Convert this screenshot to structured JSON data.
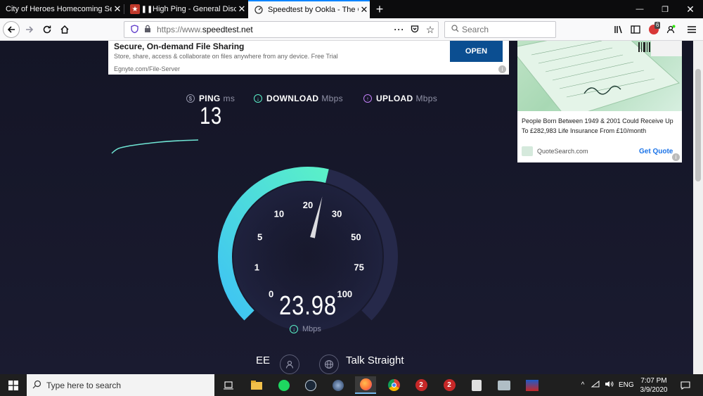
{
  "browser": {
    "tabs": [
      {
        "label": "City of Heroes Homecoming Server",
        "active": false
      },
      {
        "label": "High Ping - General Discussion",
        "active": false
      },
      {
        "label": "Speedtest by Ookla - The Global",
        "active": true
      }
    ],
    "url_protocol": "https://www.",
    "url_domain": "speedtest.net",
    "search_placeholder": "Search",
    "badge_count": "6"
  },
  "ad_top": {
    "title": "Secure, On-demand File Sharing",
    "description": "Store, share, access & collaborate on files anywhere from any device. Free Trial",
    "source": "Egnyte.com/File-Server",
    "cta": "OPEN"
  },
  "ad_side": {
    "text": "People Born Between 1949 & 2001 Could Receive Up To £282,983 Life Insurance From £10/month",
    "source": "QuoteSearch.com",
    "cta": "Get Quote"
  },
  "metrics": {
    "ping_label": "PING",
    "ping_unit": "ms",
    "ping_value": "13",
    "download_label": "DOWNLOAD",
    "download_unit": "Mbps",
    "upload_label": "UPLOAD",
    "upload_unit": "Mbps"
  },
  "gauge": {
    "ticks": [
      "0",
      "1",
      "5",
      "10",
      "20",
      "30",
      "50",
      "75",
      "100"
    ],
    "value": "23.98",
    "unit": "Mbps",
    "needle_value": 23.98,
    "accent_start": "#3ec3f4",
    "accent_end": "#5af0c8"
  },
  "isp": {
    "provider": "EE",
    "server": "Talk Straight"
  },
  "taskbar": {
    "search_placeholder": "Type here to search",
    "language": "ENG",
    "time": "7:07 PM",
    "date": "3/9/2020"
  }
}
